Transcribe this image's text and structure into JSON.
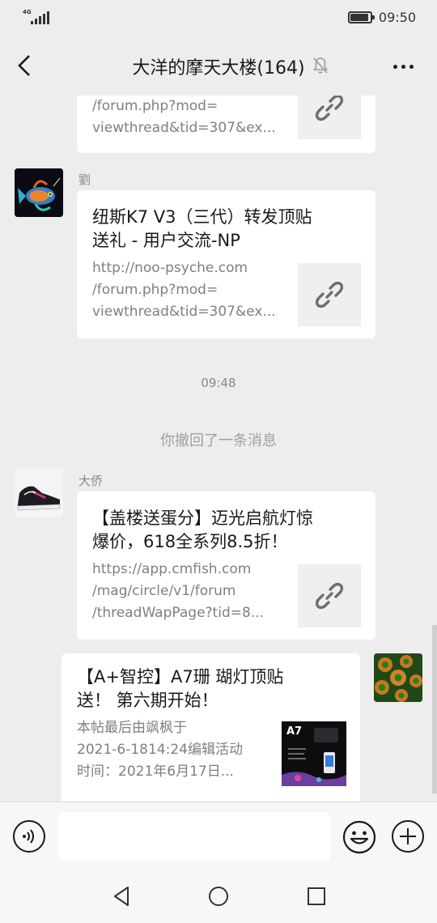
{
  "status_bar": {
    "network": "4G",
    "time": "09:50"
  },
  "header": {
    "title": "大洋的摩天大楼(164)"
  },
  "messages": [
    {
      "sender": "",
      "url_lines": [
        "/forum.php?mod=",
        "viewthread&tid=307&ex..."
      ]
    },
    {
      "sender": "劉",
      "title_lines": [
        "纽斯K7 V3（三代）转发顶贴",
        "送礼 - 用户交流-NP"
      ],
      "url_lines": [
        "http://noo-psyche.com",
        "/forum.php?mod=",
        "viewthread&tid=307&ex..."
      ]
    },
    {
      "timestamp": "09:48"
    },
    {
      "system": "你撤回了一条消息"
    },
    {
      "sender": "大侨",
      "title_lines": [
        "【盖楼送蛋分】迈光启航灯惊",
        "爆价，618全系列8.5折！"
      ],
      "url_lines": [
        "https://app.cmfish.com",
        "/mag/circle/v1/forum",
        "/threadWapPage?tid=8..."
      ]
    },
    {
      "title_lines": [
        "【A+智控】A7珊 瑚灯顶贴",
        "送！ 第六期开始！"
      ],
      "desc_lines": [
        "本帖最后由飒枫于",
        "2021-6-1814:24编辑活动",
        "时间：2021年6月17日..."
      ],
      "thumb_text": "A7"
    }
  ],
  "input": {
    "placeholder": ""
  },
  "colors": {
    "bubble": "#ffffff",
    "background": "#ededed",
    "secondary_text": "#7f7f7f"
  }
}
